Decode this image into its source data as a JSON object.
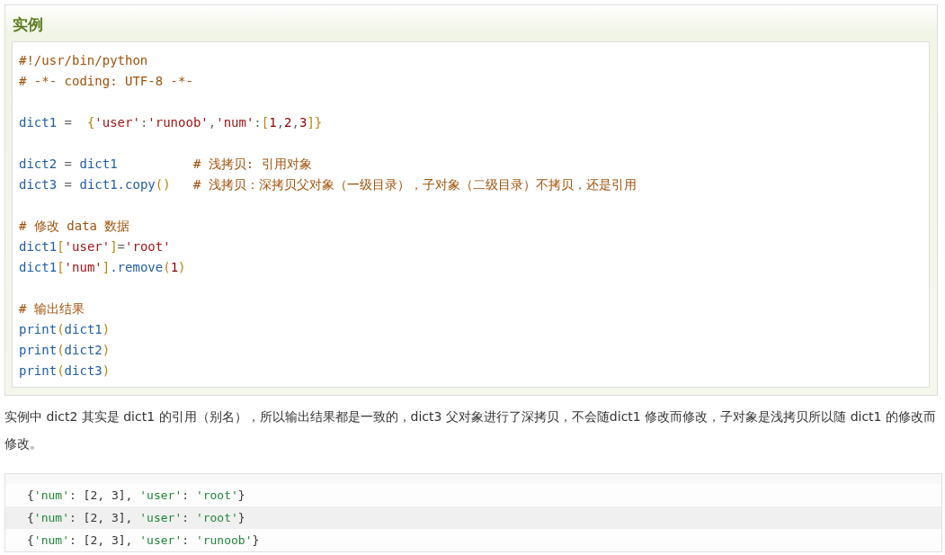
{
  "example": {
    "title": "实例",
    "code_lines": [
      {
        "kind": "code",
        "tokens": [
          {
            "kind": "comment",
            "text": "#!/usr/bin/python"
          }
        ]
      },
      {
        "kind": "code",
        "tokens": [
          {
            "kind": "comment",
            "text": "# -*- coding: UTF-8 -*-"
          }
        ]
      },
      {
        "kind": "blank"
      },
      {
        "kind": "code",
        "tokens": [
          {
            "kind": "name",
            "text": "dict1"
          },
          {
            "kind": "op",
            "text": " =  "
          },
          {
            "kind": "bracket",
            "text": "{"
          },
          {
            "kind": "string",
            "text": "'user'"
          },
          {
            "kind": "op",
            "text": ":"
          },
          {
            "kind": "string",
            "text": "'runoob'"
          },
          {
            "kind": "op",
            "text": ","
          },
          {
            "kind": "string",
            "text": "'num'"
          },
          {
            "kind": "op",
            "text": ":"
          },
          {
            "kind": "bracket",
            "text": "["
          },
          {
            "kind": "number",
            "text": "1"
          },
          {
            "kind": "op",
            "text": ","
          },
          {
            "kind": "number",
            "text": "2"
          },
          {
            "kind": "op",
            "text": ","
          },
          {
            "kind": "number",
            "text": "3"
          },
          {
            "kind": "bracket",
            "text": "]}"
          }
        ]
      },
      {
        "kind": "blank"
      },
      {
        "kind": "code",
        "tokens": [
          {
            "kind": "name",
            "text": "dict2"
          },
          {
            "kind": "op",
            "text": " = "
          },
          {
            "kind": "name",
            "text": "dict1          "
          },
          {
            "kind": "comment",
            "text": "# 浅拷贝: 引用对象"
          }
        ]
      },
      {
        "kind": "code",
        "tokens": [
          {
            "kind": "name",
            "text": "dict3"
          },
          {
            "kind": "op",
            "text": " = "
          },
          {
            "kind": "name",
            "text": "dict1.copy"
          },
          {
            "kind": "bracket",
            "text": "()   "
          },
          {
            "kind": "comment",
            "text": "# 浅拷贝：深拷贝父对象（一级目录），子对象（二级目录）不拷贝，还是引用"
          }
        ]
      },
      {
        "kind": "blank"
      },
      {
        "kind": "code",
        "tokens": [
          {
            "kind": "comment",
            "text": "# 修改 data 数据"
          }
        ]
      },
      {
        "kind": "code",
        "tokens": [
          {
            "kind": "name",
            "text": "dict1"
          },
          {
            "kind": "bracket",
            "text": "["
          },
          {
            "kind": "string",
            "text": "'user'"
          },
          {
            "kind": "bracket",
            "text": "]"
          },
          {
            "kind": "op",
            "text": "="
          },
          {
            "kind": "string",
            "text": "'root'"
          }
        ]
      },
      {
        "kind": "code",
        "tokens": [
          {
            "kind": "name",
            "text": "dict1"
          },
          {
            "kind": "bracket",
            "text": "["
          },
          {
            "kind": "string",
            "text": "'num'"
          },
          {
            "kind": "bracket",
            "text": "]"
          },
          {
            "kind": "name",
            "text": ".remove"
          },
          {
            "kind": "bracket",
            "text": "("
          },
          {
            "kind": "number",
            "text": "1"
          },
          {
            "kind": "bracket",
            "text": ")"
          }
        ]
      },
      {
        "kind": "blank"
      },
      {
        "kind": "code",
        "tokens": [
          {
            "kind": "comment",
            "text": "# 输出结果"
          }
        ]
      },
      {
        "kind": "code",
        "tokens": [
          {
            "kind": "name",
            "text": "print"
          },
          {
            "kind": "bracket",
            "text": "("
          },
          {
            "kind": "name",
            "text": "dict1"
          },
          {
            "kind": "bracket",
            "text": ")"
          }
        ]
      },
      {
        "kind": "code",
        "tokens": [
          {
            "kind": "name",
            "text": "print"
          },
          {
            "kind": "bracket",
            "text": "("
          },
          {
            "kind": "name",
            "text": "dict2"
          },
          {
            "kind": "bracket",
            "text": ")"
          }
        ]
      },
      {
        "kind": "code",
        "tokens": [
          {
            "kind": "name",
            "text": "print"
          },
          {
            "kind": "bracket",
            "text": "("
          },
          {
            "kind": "name",
            "text": "dict3"
          },
          {
            "kind": "bracket",
            "text": ")"
          }
        ]
      }
    ]
  },
  "explanation": "实例中 dict2 其实是 dict1 的引用（别名），所以输出结果都是一致的，dict3 父对象进行了深拷贝，不会随dict1 修改而修改，子对象是浅拷贝所以随 dict1 的修改而修改。",
  "output_lines": [
    [
      {
        "kind": "plain",
        "text": "{"
      },
      {
        "kind": "string",
        "text": "'num'"
      },
      {
        "kind": "plain",
        "text": ": [2, 3], "
      },
      {
        "kind": "string",
        "text": "'user'"
      },
      {
        "kind": "plain",
        "text": ": "
      },
      {
        "kind": "string",
        "text": "'root'"
      },
      {
        "kind": "plain",
        "text": "}"
      }
    ],
    [
      {
        "kind": "plain",
        "text": "{"
      },
      {
        "kind": "string",
        "text": "'num'"
      },
      {
        "kind": "plain",
        "text": ": [2, 3], "
      },
      {
        "kind": "string",
        "text": "'user'"
      },
      {
        "kind": "plain",
        "text": ": "
      },
      {
        "kind": "string",
        "text": "'root'"
      },
      {
        "kind": "plain",
        "text": "}"
      }
    ],
    [
      {
        "kind": "plain",
        "text": "{"
      },
      {
        "kind": "string",
        "text": "'num'"
      },
      {
        "kind": "plain",
        "text": ": [2, 3], "
      },
      {
        "kind": "string",
        "text": "'user'"
      },
      {
        "kind": "plain",
        "text": ": "
      },
      {
        "kind": "string",
        "text": "'runoob'"
      },
      {
        "kind": "plain",
        "text": "}"
      }
    ]
  ]
}
